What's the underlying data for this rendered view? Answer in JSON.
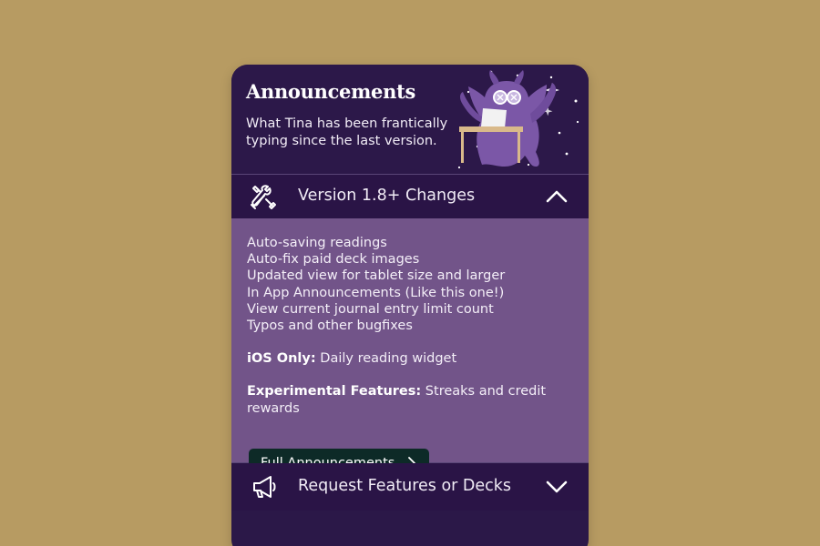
{
  "header": {
    "title": "Announcements",
    "subtitle": "What Tina has been frantically typing since the last version."
  },
  "sections": [
    {
      "label": "Version 1.8+ Changes",
      "icon": "tools-icon",
      "expanded": true,
      "changes": [
        "Auto-saving readings",
        "Auto-fix paid deck images",
        "Updated view for tablet size and larger",
        "In App Announcements (Like this one!)",
        "View current journal entry limit count",
        "Typos and other bugfixes"
      ],
      "ios_label": "iOS Only:",
      "ios_text": " Daily reading widget",
      "exp_label": "Experimental Features:",
      "exp_text": " Streaks and credit rewards",
      "button_label": "Full Announcements"
    },
    {
      "label": "Request Features or Decks",
      "icon": "megaphone-icon",
      "expanded": false
    }
  ],
  "colors": {
    "background": "#b79b62",
    "card_dark": "#2a1446",
    "card_body": "#725489",
    "button": "#0d2a27",
    "text": "#f1ecf6"
  }
}
